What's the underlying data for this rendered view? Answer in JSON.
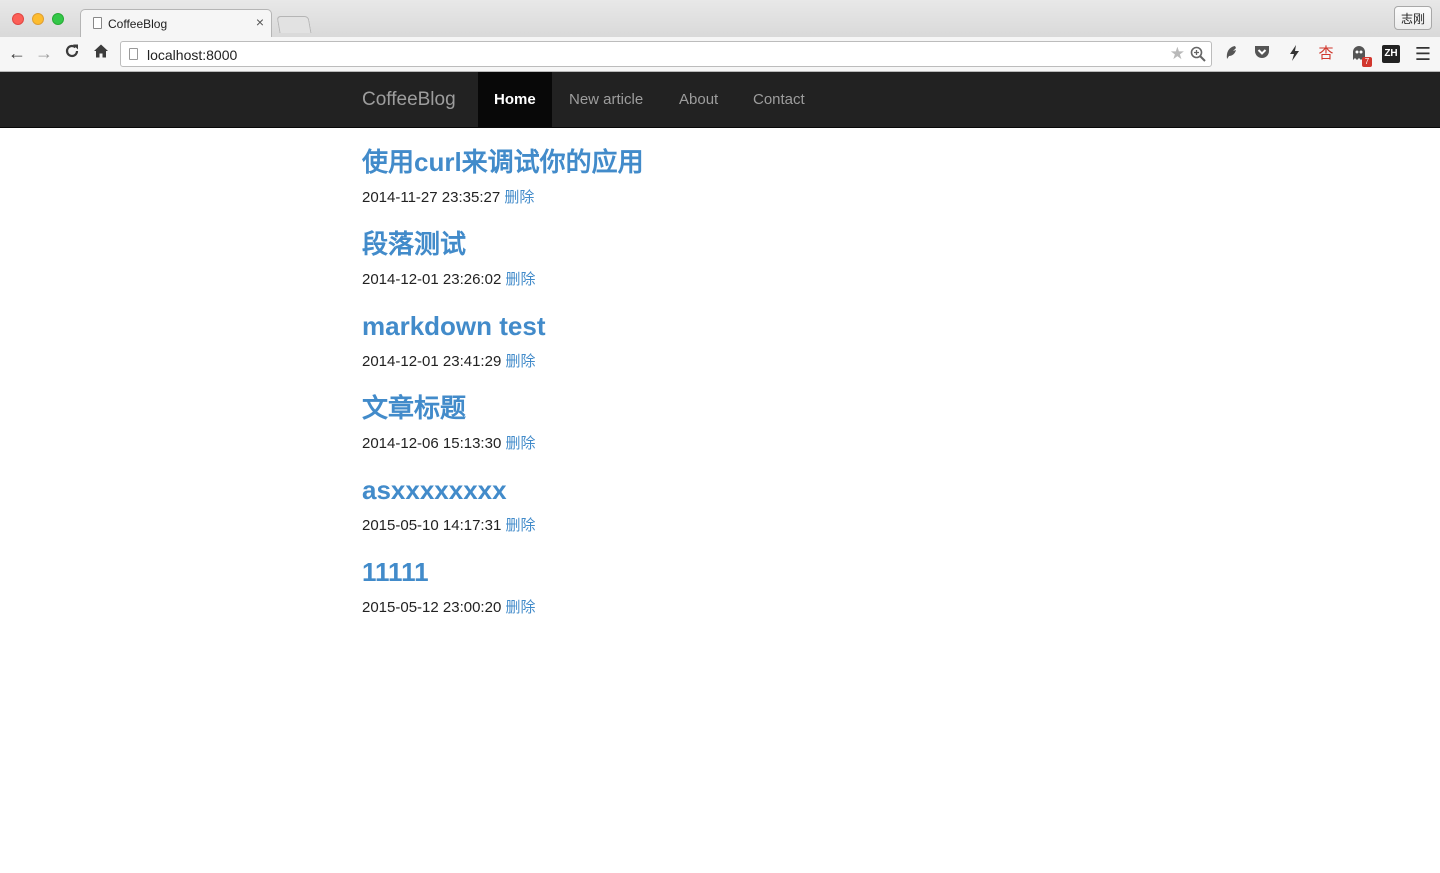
{
  "browser": {
    "tab_title": "CoffeeBlog",
    "tab_close": "×",
    "profile_name": "志刚",
    "url": "localhost:8000",
    "ext_zh_label": "ZH",
    "ext_badge_count": "7"
  },
  "navbar": {
    "brand": "CoffeeBlog",
    "items": [
      {
        "label": "Home",
        "active": true
      },
      {
        "label": "New article",
        "active": false
      },
      {
        "label": "About",
        "active": false
      },
      {
        "label": "Contact",
        "active": false
      }
    ]
  },
  "articles": [
    {
      "title": "使用curl来调试你的应用",
      "date": "2014-11-27 23:35:27",
      "delete_label": "删除"
    },
    {
      "title": "段落测试",
      "date": "2014-12-01 23:26:02",
      "delete_label": "删除"
    },
    {
      "title": "markdown test",
      "date": "2014-12-01 23:41:29",
      "delete_label": "删除"
    },
    {
      "title": "文章标题",
      "date": "2014-12-06 15:13:30",
      "delete_label": "删除"
    },
    {
      "title": "asxxxxxxxx",
      "date": "2015-05-10 14:17:31",
      "delete_label": "删除"
    },
    {
      "title": "11111",
      "date": "2015-05-12 23:00:20",
      "delete_label": "删除"
    }
  ],
  "colors": {
    "navbar_bg": "#222222",
    "link_blue": "#428bca",
    "nav_text": "#9d9d9d"
  }
}
